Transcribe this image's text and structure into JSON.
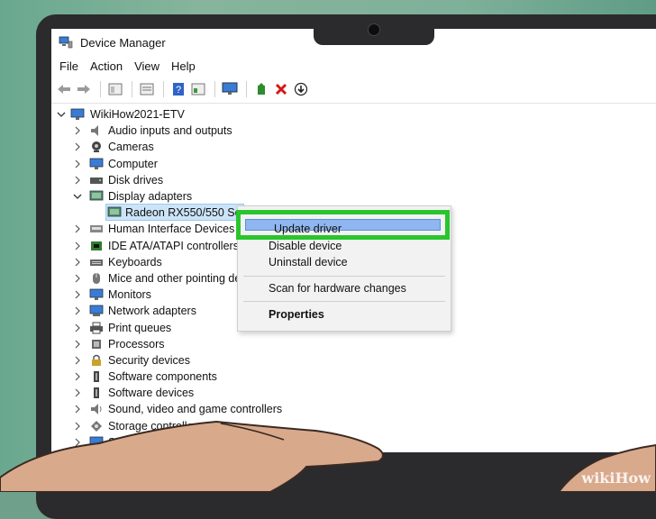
{
  "window": {
    "title": "Device Manager"
  },
  "menubar": [
    "File",
    "Action",
    "View",
    "Help"
  ],
  "toolbar": {
    "icons": [
      "back-icon",
      "forward-icon",
      "properties-pane-icon",
      "list-icon",
      "help-icon",
      "view-icon",
      "monitor-icon",
      "update-driver-icon",
      "uninstall-icon",
      "download-icon"
    ]
  },
  "tree": {
    "root": "WikiHow2021-ETV",
    "items": [
      {
        "label": "Audio inputs and outputs",
        "icon": "speaker-icon",
        "expanded": false
      },
      {
        "label": "Cameras",
        "icon": "camera-icon",
        "expanded": false
      },
      {
        "label": "Computer",
        "icon": "computer-icon",
        "expanded": false
      },
      {
        "label": "Disk drives",
        "icon": "disk-icon",
        "expanded": false
      },
      {
        "label": "Display adapters",
        "icon": "display-adapter-icon",
        "expanded": true
      },
      {
        "label": "Radeon RX550/550 Ser",
        "icon": "display-adapter-icon",
        "child": true,
        "selected": true
      },
      {
        "label": "Human Interface Devices",
        "icon": "hid-icon",
        "expanded": false
      },
      {
        "label": "IDE ATA/ATAPI controllers",
        "icon": "ide-icon",
        "expanded": false
      },
      {
        "label": "Keyboards",
        "icon": "keyboard-icon",
        "expanded": false
      },
      {
        "label": "Mice and other pointing de",
        "icon": "mouse-icon",
        "expanded": false
      },
      {
        "label": "Monitors",
        "icon": "monitor-icon",
        "expanded": false
      },
      {
        "label": "Network adapters",
        "icon": "network-icon",
        "expanded": false
      },
      {
        "label": "Print queues",
        "icon": "printer-icon",
        "expanded": false
      },
      {
        "label": "Processors",
        "icon": "processor-icon",
        "expanded": false
      },
      {
        "label": "Security devices",
        "icon": "security-icon",
        "expanded": false
      },
      {
        "label": "Software components",
        "icon": "software-icon",
        "expanded": false
      },
      {
        "label": "Software devices",
        "icon": "software-icon",
        "expanded": false
      },
      {
        "label": "Sound, video and game controllers",
        "icon": "sound-icon",
        "expanded": false
      },
      {
        "label": "Storage controllers",
        "icon": "storage-icon",
        "expanded": false
      },
      {
        "label": "System devic",
        "icon": "system-icon",
        "expanded": false
      }
    ]
  },
  "context_menu": {
    "items": [
      "Update driver",
      "Disable device",
      "Uninstall device",
      "Scan for hardware changes",
      "Properties"
    ],
    "highlighted": "Update driver"
  },
  "colors": {
    "highlight_border": "#29c52c",
    "menu_selected": "#8fb6ef",
    "tree_selected": "#cce4f7"
  },
  "watermark": {
    "wiki": "wiki",
    "how": "How"
  }
}
